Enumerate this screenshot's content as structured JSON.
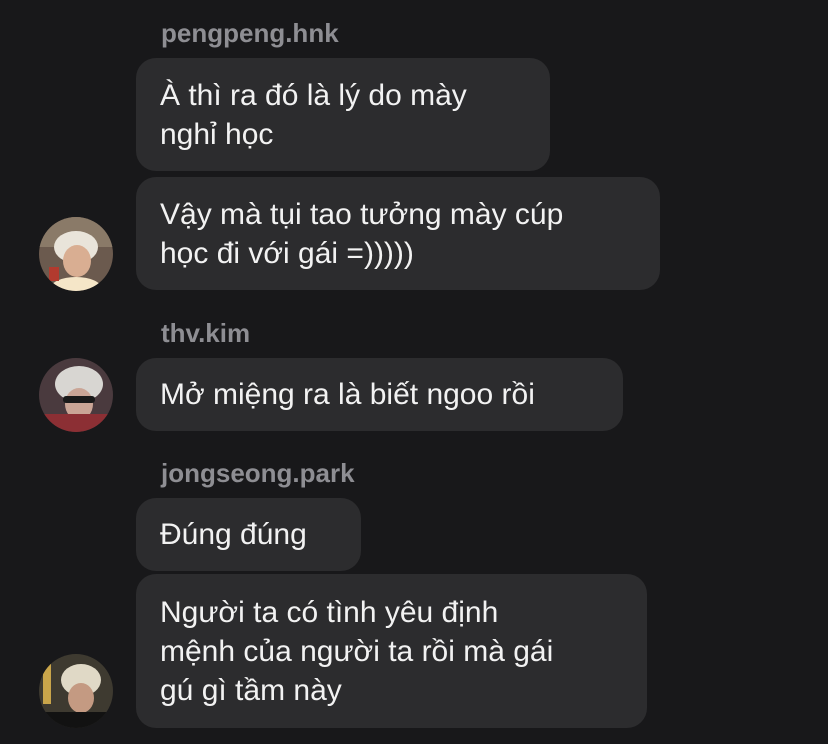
{
  "thread": [
    {
      "sender": "pengpeng.hnk",
      "messages": [
        {
          "text": "À thì ra đó là lý do mày\nnghỉ học"
        },
        {
          "text": "Vậy mà tụi tao tưởng mày cúp\nhọc đi với gái =)))))"
        }
      ]
    },
    {
      "sender": "thv.kim",
      "messages": [
        {
          "text": "Mở miệng ra là biết ngoo rồi"
        }
      ]
    },
    {
      "sender": "jongseong.park",
      "messages": [
        {
          "text": "Đúng đúng"
        },
        {
          "text": "Người ta có tình yêu định\nmệnh của người ta rồi mà gái\ngú gì tầm này"
        }
      ]
    }
  ],
  "colors": {
    "background": "#18181a",
    "bubble": "#2c2c2e",
    "message_text": "#f2f2f2",
    "sender_text": "#8e8e93"
  }
}
